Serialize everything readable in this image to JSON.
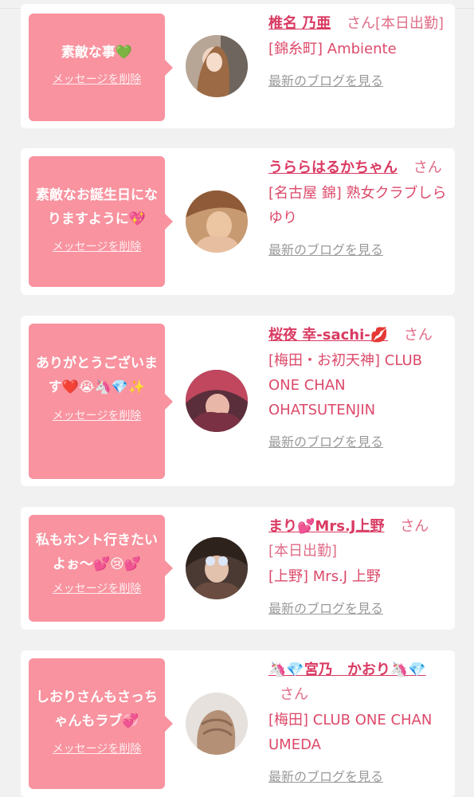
{
  "cards": [
    {
      "message": "素敵な事💚",
      "delete_label": "メッセージを削除",
      "name": "椎名 乃亜",
      "suffix": "さん[本日出勤]",
      "shop": "[錦糸町] Ambiente",
      "blog_label": "最新のブログを見る"
    },
    {
      "message": "素敵なお誕生日になりますように💖",
      "delete_label": "メッセージを削除",
      "name": "うららはるかちゃん",
      "suffix": "さん",
      "shop": "[名古屋 錦] 熟女クラブしらゆり",
      "blog_label": "最新のブログを見る"
    },
    {
      "message": "ありがとうございます❤️😭🦄💎✨",
      "delete_label": "メッセージを削除",
      "name": "桜夜 幸-sachi-💋",
      "suffix": "さん",
      "shop": "[梅田・お初天神] CLUB ONE CHAN OHATSUTENJIN",
      "blog_label": "最新のブログを見る"
    },
    {
      "message": "私もホント行きたいよぉ〜💕😢💕",
      "delete_label": "メッセージを削除",
      "name": "まり💕Mrs.J上野",
      "suffix": "さん[本日出勤]",
      "shop": "[上野] Mrs.J 上野",
      "blog_label": "最新のブログを見る"
    },
    {
      "message": "しおりさんもさっちゃんもラブ💞",
      "delete_label": "メッセージを削除",
      "name": "🦄💎宮乃　かおり🦄💎",
      "suffix": "さん",
      "shop": "[梅田] CLUB ONE CHAN UMEDA",
      "blog_label": "最新のブログを見る"
    }
  ],
  "colors": {
    "bubble": "#f8939f",
    "name": "#d93a62",
    "text": "#dc4a6a",
    "link_gray": "#9a9a9a",
    "background": "#f2f1f1"
  }
}
